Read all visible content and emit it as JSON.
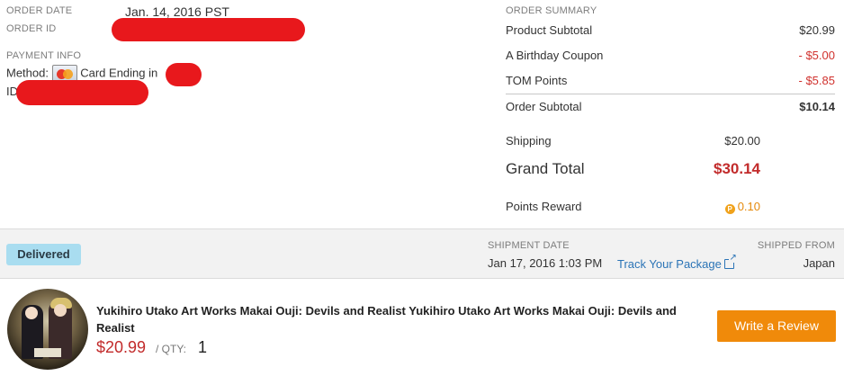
{
  "order": {
    "date_label": "ORDER DATE",
    "date_value": "Jan. 14, 2016 PST",
    "id_label": "ORDER ID"
  },
  "payment": {
    "section_label": "PAYMENT INFO",
    "method_label": "Method:",
    "card_icon": "mastercard-icon",
    "card_text": "Card Ending in",
    "id_label": "ID"
  },
  "summary": {
    "title": "ORDER SUMMARY",
    "rows": [
      {
        "label": "Product Subtotal",
        "value": "$20.99"
      },
      {
        "label": "A Birthday Coupon",
        "value": "- $5.00"
      },
      {
        "label": "TOM Points",
        "value": "- $5.85"
      }
    ],
    "order_subtotal_label": "Order Subtotal",
    "order_subtotal_value": "$10.14",
    "shipping_label": "Shipping",
    "shipping_value": "$20.00",
    "grand_total_label": "Grand Total",
    "grand_total_value": "$30.14",
    "points_reward_label": "Points Reward",
    "points_reward_value": "0.10",
    "discount_color": "#d0312d",
    "total_color": "#c22b2b"
  },
  "shipment": {
    "status": "Delivered",
    "date_label": "SHIPMENT DATE",
    "date_value": "Jan 17, 2016 1:03 PM",
    "track_label": "Track Your Package",
    "shipped_from_label": "SHIPPED FROM",
    "shipped_from_value": "Japan",
    "badge_color": "#a9ddf0",
    "link_color": "#2b74b6"
  },
  "product": {
    "title": "Yukihiro Utako Art Works Makai Ouji: Devils and Realist Yukihiro Utako Art Works Makai Ouji: Devils and Realist",
    "price": "$20.99",
    "qty_label": "/ QTY:",
    "qty_value": "1",
    "review_button": "Write a Review",
    "button_color": "#f08a0a"
  }
}
